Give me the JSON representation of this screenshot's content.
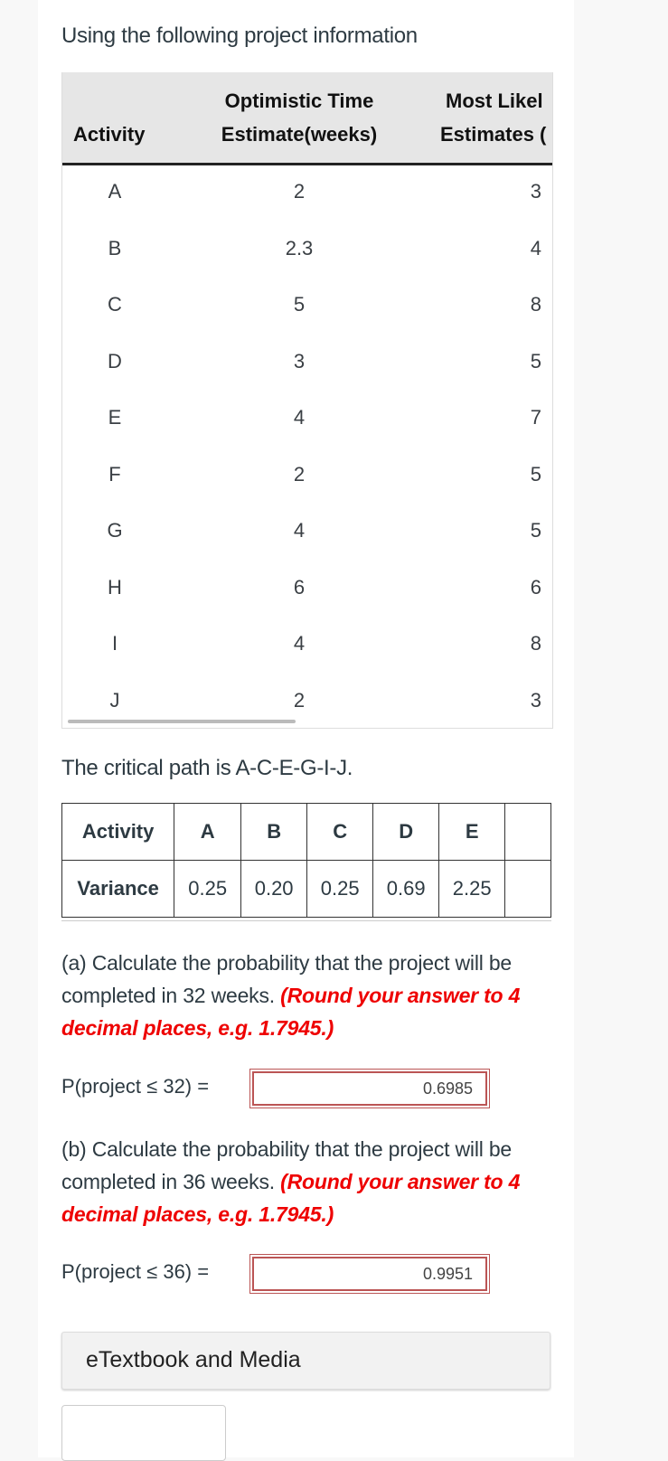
{
  "intro": "Using the following project information",
  "table1": {
    "headers": {
      "activity": "Activity",
      "optimistic_1": "Optimistic Time",
      "optimistic_2": "Estimate(weeks)",
      "likely_1": "Most Likel",
      "likely_2": "Estimates ("
    },
    "rows": [
      {
        "activity": "A",
        "optimistic": "2",
        "likely": "3"
      },
      {
        "activity": "B",
        "optimistic": "2.3",
        "likely": "4"
      },
      {
        "activity": "C",
        "optimistic": "5",
        "likely": "8"
      },
      {
        "activity": "D",
        "optimistic": "3",
        "likely": "5"
      },
      {
        "activity": "E",
        "optimistic": "4",
        "likely": "7"
      },
      {
        "activity": "F",
        "optimistic": "2",
        "likely": "5"
      },
      {
        "activity": "G",
        "optimistic": "4",
        "likely": "5"
      },
      {
        "activity": "H",
        "optimistic": "6",
        "likely": "6"
      },
      {
        "activity": "I",
        "optimistic": "4",
        "likely": "8"
      },
      {
        "activity": "J",
        "optimistic": "2",
        "likely": "3"
      }
    ]
  },
  "critical_path": "The critical path is A-C-E-G-I-J.",
  "table2": {
    "row1": [
      "Activity",
      "A",
      "B",
      "C",
      "D",
      "E",
      ""
    ],
    "row2": [
      "Variance",
      "0.25",
      "0.20",
      "0.25",
      "0.69",
      "2.25",
      ""
    ]
  },
  "part_a": {
    "text": "(a) Calculate the probability that the project will be completed in 32 weeks. ",
    "note": "(Round your answer to 4 decimal places, e.g. 1.7945.)",
    "label": "P(project ≤ 32) =",
    "value": "0.6985"
  },
  "part_b": {
    "text": "(b) Calculate the probability that the project will be completed in 36 weeks. ",
    "note": "(Round your answer to 4 decimal places, e.g. 1.7945.)",
    "label": "P(project ≤ 36) =",
    "value": "0.9951"
  },
  "etextbook": "eTextbook and Media",
  "colors": {
    "note_red": "#e00000",
    "answer_border": "#b55555",
    "header_bg": "#e6e6e6"
  }
}
